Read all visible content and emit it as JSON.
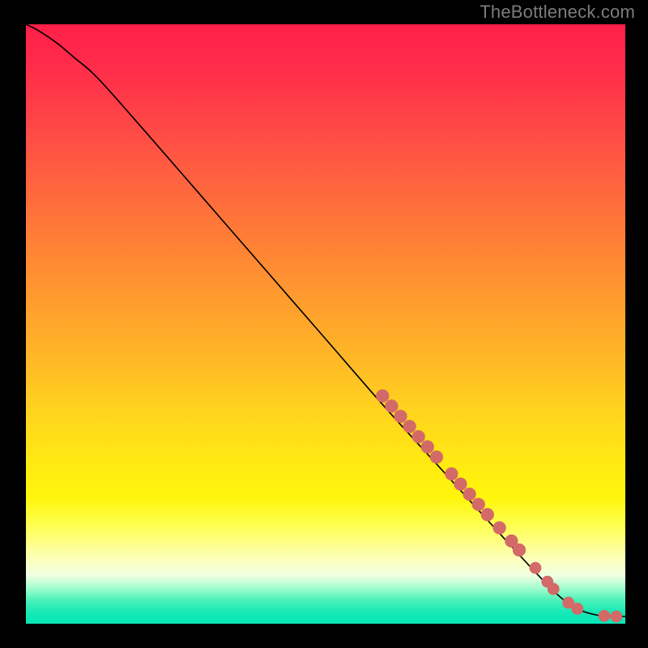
{
  "watermark": "TheBottleneck.com",
  "chart_data": {
    "type": "line",
    "title": "",
    "xlabel": "",
    "ylabel": "",
    "xlim": [
      0,
      100
    ],
    "ylim": [
      0,
      100
    ],
    "series": [
      {
        "name": "curve",
        "x": [
          0,
          2,
          5,
          8,
          12,
          20,
          30,
          40,
          50,
          60,
          70,
          80,
          88,
          92,
          95,
          97,
          100
        ],
        "y": [
          100,
          99,
          97,
          94.5,
          91,
          82,
          70.5,
          59,
          47.5,
          36,
          25,
          14,
          5.5,
          2.5,
          1.5,
          1.3,
          1.2
        ]
      }
    ],
    "markers": [
      {
        "x": 59.5,
        "y": 38.0,
        "r": 1.1
      },
      {
        "x": 61.0,
        "y": 36.3,
        "r": 1.1
      },
      {
        "x": 62.5,
        "y": 34.6,
        "r": 1.1
      },
      {
        "x": 64.0,
        "y": 32.9,
        "r": 1.1
      },
      {
        "x": 65.5,
        "y": 31.2,
        "r": 1.1
      },
      {
        "x": 67.0,
        "y": 29.5,
        "r": 1.1
      },
      {
        "x": 68.5,
        "y": 27.8,
        "r": 1.1
      },
      {
        "x": 71.0,
        "y": 25.0,
        "r": 1.1
      },
      {
        "x": 72.5,
        "y": 23.3,
        "r": 1.1
      },
      {
        "x": 74.0,
        "y": 21.6,
        "r": 1.1
      },
      {
        "x": 75.5,
        "y": 19.9,
        "r": 1.1
      },
      {
        "x": 77.0,
        "y": 18.2,
        "r": 1.1
      },
      {
        "x": 79.0,
        "y": 16.0,
        "r": 1.1
      },
      {
        "x": 81.0,
        "y": 13.8,
        "r": 1.1
      },
      {
        "x": 82.3,
        "y": 12.3,
        "r": 1.1
      },
      {
        "x": 85.0,
        "y": 9.3,
        "r": 1.0
      },
      {
        "x": 87.0,
        "y": 7.0,
        "r": 1.0
      },
      {
        "x": 88.0,
        "y": 5.8,
        "r": 1.0
      },
      {
        "x": 90.5,
        "y": 3.5,
        "r": 1.0
      },
      {
        "x": 92.0,
        "y": 2.5,
        "r": 1.0
      },
      {
        "x": 96.5,
        "y": 1.3,
        "r": 1.0
      },
      {
        "x": 98.5,
        "y": 1.2,
        "r": 1.0
      }
    ],
    "gradient_stops": [
      {
        "pos": 0.0,
        "color": "#ff1f49"
      },
      {
        "pos": 0.5,
        "color": "#ffb826"
      },
      {
        "pos": 0.8,
        "color": "#fff60b"
      },
      {
        "pos": 1.0,
        "color": "#03e7b7"
      }
    ]
  }
}
